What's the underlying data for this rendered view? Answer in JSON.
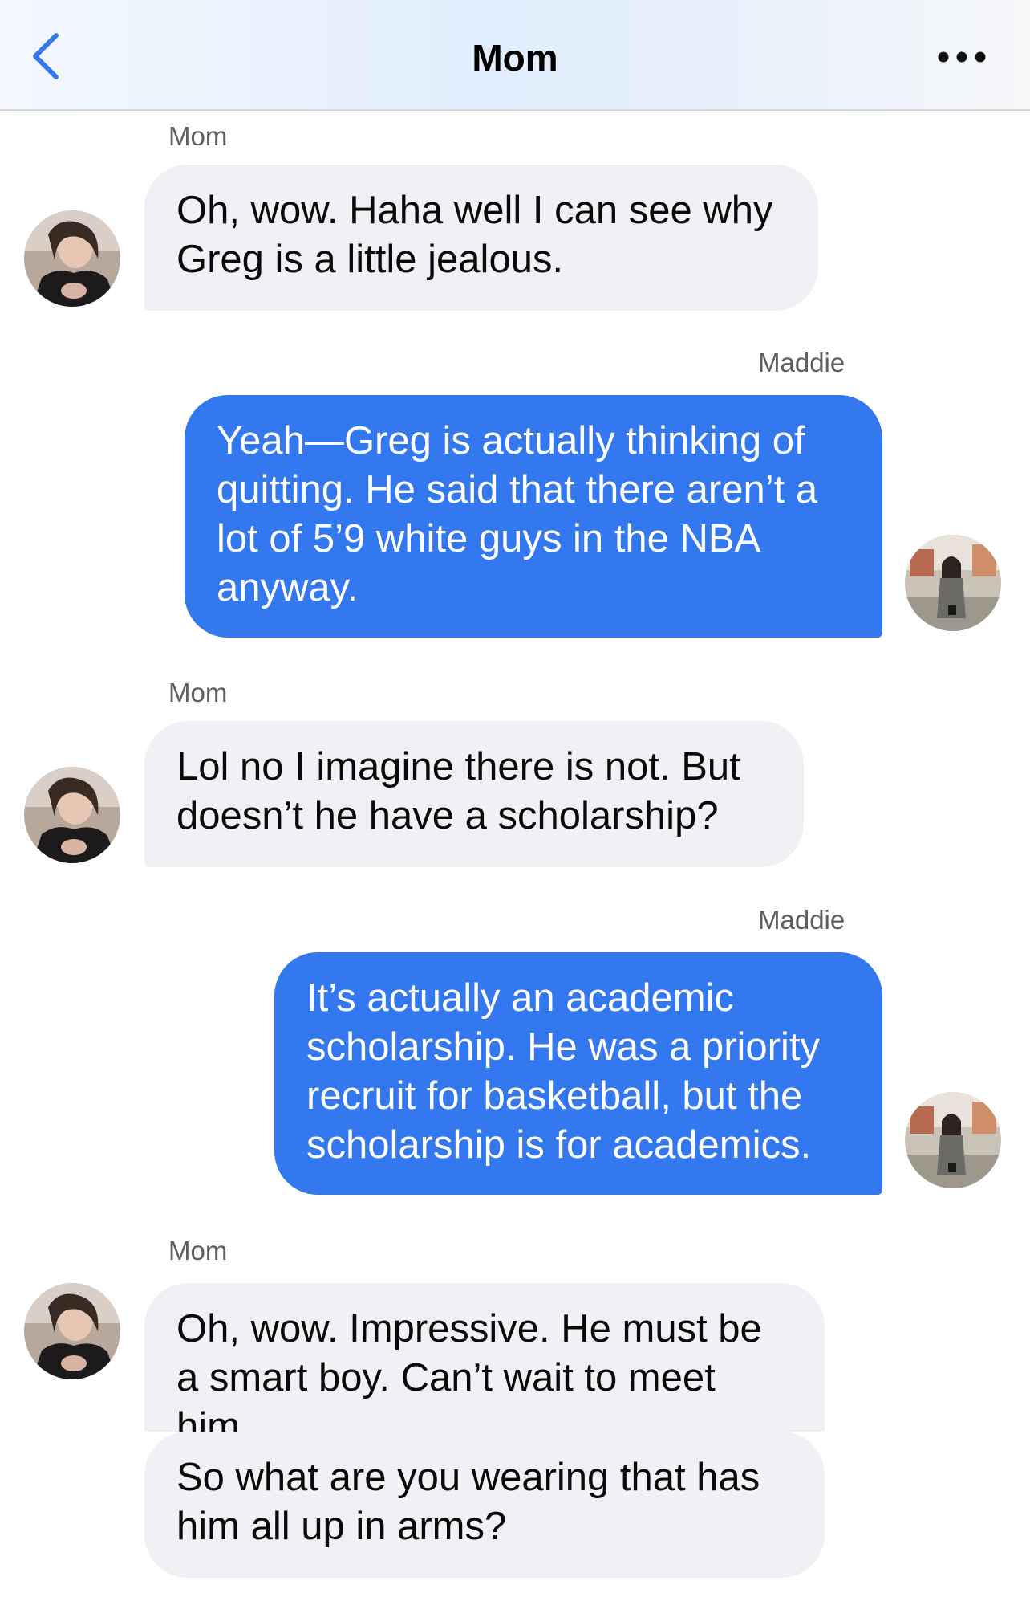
{
  "header": {
    "title": "Mom",
    "back_icon": "chevron-left-icon",
    "more_icon": "ellipsis-icon",
    "accent": "#3478f0"
  },
  "messages": [
    {
      "sender": "Mom",
      "direction": "incoming",
      "text": "Oh, wow. Haha well I can see why Greg is a little jealous."
    },
    {
      "sender": "Maddie",
      "direction": "outgoing",
      "text": "Yeah—Greg is actually thinking of quitting. He said that there aren’t a lot of 5’9 white guys in the NBA anyway."
    },
    {
      "sender": "Mom",
      "direction": "incoming",
      "text": "Lol no I imagine there is not. But doesn’t he have a scholarship?"
    },
    {
      "sender": "Maddie",
      "direction": "outgoing",
      "text": "It’s actually an academic scholarship. He was a priority recruit for basketball, but the scholarship is for academics."
    },
    {
      "sender": "Mom",
      "direction": "incoming",
      "text": "Oh, wow. Impressive. He must be a smart boy. Can’t wait to meet him."
    },
    {
      "sender": "",
      "direction": "incoming",
      "text": "So what are you wearing that has him all up in arms?"
    }
  ],
  "colors": {
    "incoming_bubble": "#f0f0f5",
    "outgoing_bubble": "#3478f0",
    "sender_label": "#5d5d62"
  }
}
